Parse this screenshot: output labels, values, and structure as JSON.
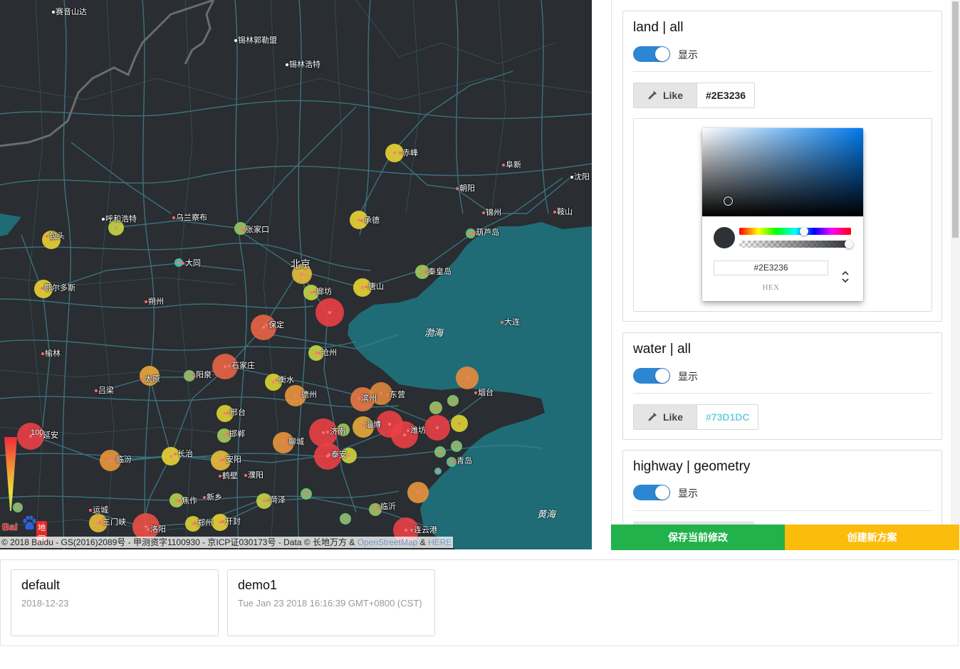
{
  "map": {
    "cities": [
      {
        "name": "赛音山达",
        "white": true
      },
      {
        "name": "锡林郭勒盟",
        "white": true
      },
      {
        "name": "锡林浩特",
        "white": true
      },
      {
        "name": "赤峰"
      },
      {
        "name": "阜新"
      },
      {
        "name": "沈阳"
      },
      {
        "name": "朝阳"
      },
      {
        "name": "锦州"
      },
      {
        "name": "鞍山"
      },
      {
        "name": "葫芦岛"
      },
      {
        "name": "呼和浩特"
      },
      {
        "name": "乌兰察布"
      },
      {
        "name": "张家口"
      },
      {
        "name": "承德"
      },
      {
        "name": "包头"
      },
      {
        "name": "大同"
      },
      {
        "name": "北京"
      },
      {
        "name": "秦皇岛"
      },
      {
        "name": "鄂尔多斯"
      },
      {
        "name": "廊坊"
      },
      {
        "name": "唐山"
      },
      {
        "name": "朔州"
      },
      {
        "name": "保定"
      },
      {
        "name": "大连"
      },
      {
        "name": "沧州"
      },
      {
        "name": "榆林"
      },
      {
        "name": "石家庄"
      },
      {
        "name": "太原"
      },
      {
        "name": "阳泉"
      },
      {
        "name": "衡水"
      },
      {
        "name": "德州"
      },
      {
        "name": "滨州"
      },
      {
        "name": "东营"
      },
      {
        "name": "烟台"
      },
      {
        "name": "吕梁"
      },
      {
        "name": "邢台"
      },
      {
        "name": "邯郸"
      },
      {
        "name": "聊城"
      },
      {
        "name": "济南"
      },
      {
        "name": "淄博"
      },
      {
        "name": "潍坊"
      },
      {
        "name": "延安"
      },
      {
        "name": "临汾"
      },
      {
        "name": "长治"
      },
      {
        "name": "安阳"
      },
      {
        "name": "泰安"
      },
      {
        "name": "青岛"
      },
      {
        "name": "鹤壁"
      },
      {
        "name": "濮阳"
      },
      {
        "name": "新乡"
      },
      {
        "name": "焦作"
      },
      {
        "name": "菏泽"
      },
      {
        "name": "临沂"
      },
      {
        "name": "运城"
      },
      {
        "name": "三门峡"
      },
      {
        "name": "郑州"
      },
      {
        "name": "开封"
      },
      {
        "name": "洛阳"
      },
      {
        "name": "连云港"
      }
    ],
    "seas": [
      "渤海",
      "黄海"
    ],
    "legend_max": "100",
    "logo_text": "Bai",
    "logo_text2": "地图",
    "copyright": "© 2018 Baidu - GS(2016)2089号 - 甲测资字1100930 - 京ICP证030173号 - Data © 长地万方 &",
    "copyright_link1": "OpenStreetMap",
    "copyright_amp": "&",
    "copyright_link2": "HERE",
    "colors": {
      "land": "#2E3236",
      "water": "#1F6C77",
      "road": "#3C7F8E"
    }
  },
  "panel": {
    "cards": [
      {
        "title": "land | all",
        "toggle_label": "显示",
        "like_label": "Like",
        "color_value": "#2E3236"
      },
      {
        "title": "water | all",
        "toggle_label": "显示",
        "like_label": "Like",
        "color_value": "#73D1DC"
      },
      {
        "title": "highway | geometry",
        "toggle_label": "显示"
      }
    ],
    "picker": {
      "hex_value": "#2E3236",
      "mode_label": "HEX"
    },
    "save_button": "保存当前修改",
    "create_button": "创建新方案"
  },
  "schemes": [
    {
      "name": "default",
      "date": "2018-12-23"
    },
    {
      "name": "demo1",
      "date": "Tue Jan 23 2018 16:16:39 GMT+0800 (CST)"
    }
  ]
}
